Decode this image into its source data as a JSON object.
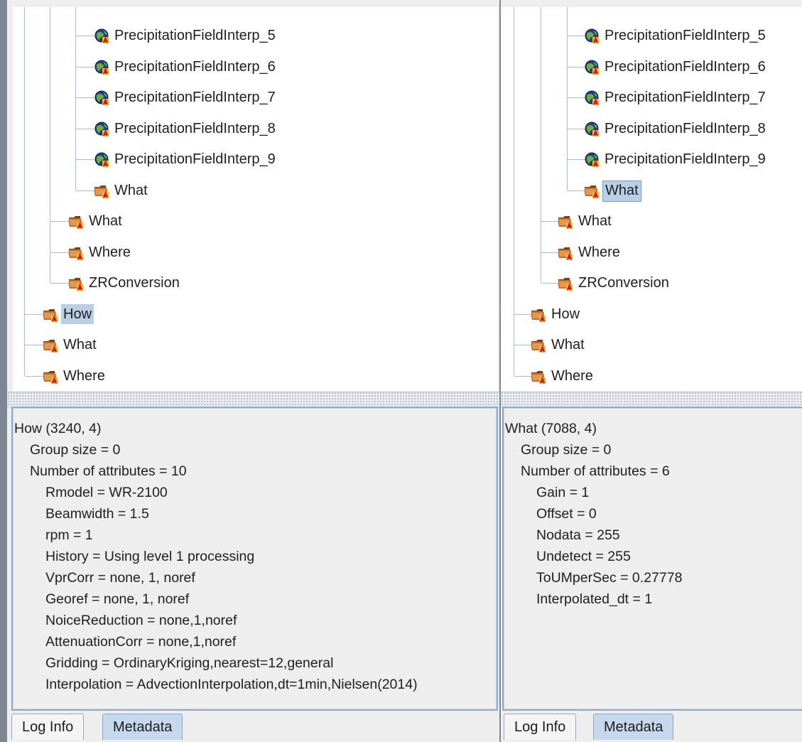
{
  "left_panel": {
    "tree": {
      "group_children": [
        "PrecipitationFieldInterp_5",
        "PrecipitationFieldInterp_6",
        "PrecipitationFieldInterp_7",
        "PrecipitationFieldInterp_8",
        "PrecipitationFieldInterp_9"
      ],
      "group_last": "What",
      "level1": [
        "What",
        "Where",
        "ZRConversion"
      ],
      "level0": [
        "How",
        "What",
        "Where"
      ],
      "selected": "How"
    },
    "metadata": {
      "header": "How (3240, 4)",
      "group_size": "Group size = 0",
      "num_attributes": "Number of attributes = 10",
      "attributes": [
        "Rmodel = WR-2100",
        "Beamwidth = 1.5",
        "rpm = 1",
        "History = Using level 1 processing",
        "VprCorr = none, 1, noref",
        "Georef = none, 1, noref",
        "NoiceReduction = none,1,noref",
        "AttenuationCorr = none,1,noref",
        "Gridding = OrdinaryKriging,nearest=12,general",
        "Interpolation = AdvectionInterpolation,dt=1min,Nielsen(2014)"
      ]
    },
    "tabs": [
      "Log Info",
      "Metadata"
    ],
    "active_tab": "Metadata"
  },
  "right_panel": {
    "tree": {
      "group_children": [
        "PrecipitationFieldInterp_5",
        "PrecipitationFieldInterp_6",
        "PrecipitationFieldInterp_7",
        "PrecipitationFieldInterp_8",
        "PrecipitationFieldInterp_9"
      ],
      "group_last": "What",
      "level1": [
        "What",
        "Where",
        "ZRConversion"
      ],
      "level0": [
        "How",
        "What",
        "Where"
      ],
      "selected": "What"
    },
    "metadata": {
      "header": "What (7088, 4)",
      "group_size": "Group size = 0",
      "num_attributes": "Number of attributes = 6",
      "attributes": [
        "Gain = 1",
        "Offset = 0",
        "Nodata = 255",
        "Undetect = 255",
        "ToUMperSec = 0.27778",
        "Interpolated_dt = 1"
      ]
    },
    "tabs": [
      "Log Info",
      "Metadata"
    ],
    "active_tab": "Metadata"
  },
  "icons": {
    "dataset": "globe-dataset-icon",
    "group": "folder-group-icon"
  },
  "colors": {
    "selection": "#b8cfe5",
    "tree_lines": "#a9bed6",
    "active_tab": "#c6d9ec"
  }
}
